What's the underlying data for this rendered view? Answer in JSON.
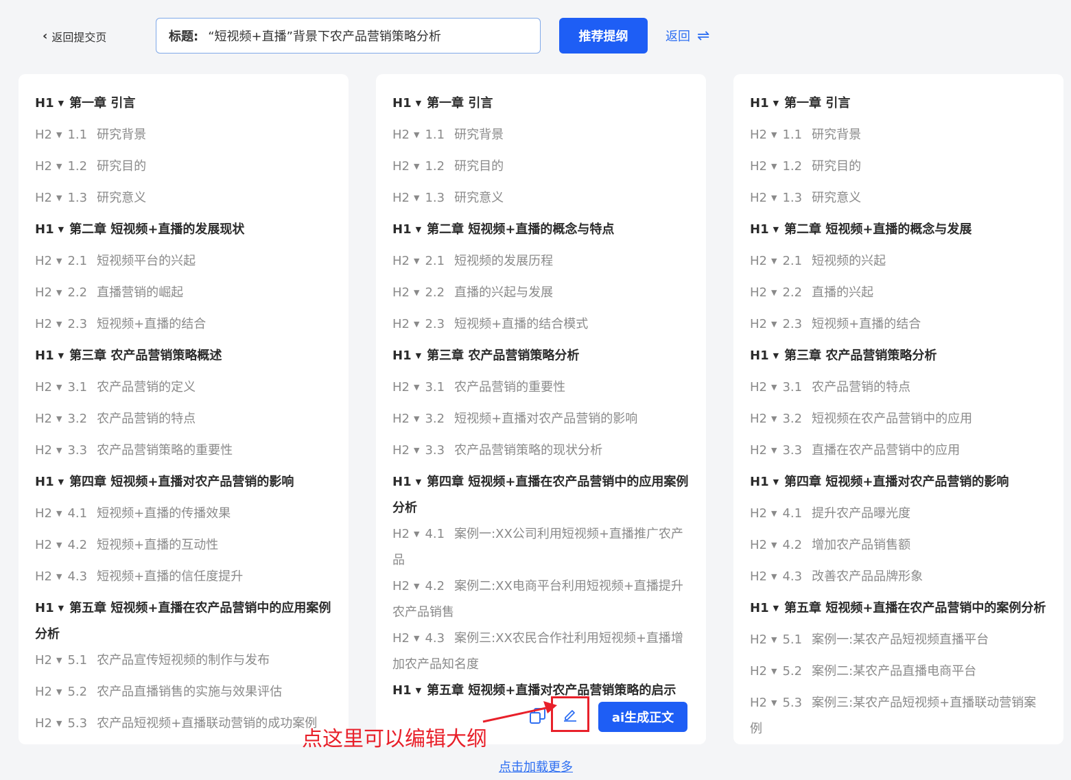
{
  "header": {
    "back_label": "返回提交页",
    "title_label": "标题:",
    "title_value": "“短视频+直播”背景下农产品营销策略分析",
    "recommend_button": "推荐提纲",
    "return_label": "返回",
    "return_icon": "swap-arrows-icon"
  },
  "outlines": [
    {
      "items": [
        {
          "level": "H1",
          "num": "",
          "text": "第一章 引言"
        },
        {
          "level": "H2",
          "num": "1.1",
          "text": "研究背景"
        },
        {
          "level": "H2",
          "num": "1.2",
          "text": "研究目的"
        },
        {
          "level": "H2",
          "num": "1.3",
          "text": "研究意义"
        },
        {
          "level": "H1",
          "num": "",
          "text": "第二章 短视频+直播的发展现状"
        },
        {
          "level": "H2",
          "num": "2.1",
          "text": "短视频平台的兴起"
        },
        {
          "level": "H2",
          "num": "2.2",
          "text": "直播营销的崛起"
        },
        {
          "level": "H2",
          "num": "2.3",
          "text": "短视频+直播的结合"
        },
        {
          "level": "H1",
          "num": "",
          "text": "第三章 农产品营销策略概述"
        },
        {
          "level": "H2",
          "num": "3.1",
          "text": "农产品营销的定义"
        },
        {
          "level": "H2",
          "num": "3.2",
          "text": "农产品营销的特点"
        },
        {
          "level": "H2",
          "num": "3.3",
          "text": "农产品营销策略的重要性"
        },
        {
          "level": "H1",
          "num": "",
          "text": "第四章 短视频+直播对农产品营销的影响"
        },
        {
          "level": "H2",
          "num": "4.1",
          "text": "短视频+直播的传播效果"
        },
        {
          "level": "H2",
          "num": "4.2",
          "text": "短视频+直播的互动性"
        },
        {
          "level": "H2",
          "num": "4.3",
          "text": "短视频+直播的信任度提升"
        },
        {
          "level": "H1",
          "num": "",
          "text": "第五章 短视频+直播在农产品营销中的应用案例分析"
        },
        {
          "level": "H2",
          "num": "5.1",
          "text": "农产品宣传短视频的制作与发布"
        },
        {
          "level": "H2",
          "num": "5.2",
          "text": "农产品直播销售的实施与效果评估"
        },
        {
          "level": "H2",
          "num": "5.3",
          "text": "农产品短视频+直播联动营销的成功案例"
        }
      ]
    },
    {
      "items": [
        {
          "level": "H1",
          "num": "",
          "text": "第一章 引言"
        },
        {
          "level": "H2",
          "num": "1.1",
          "text": "研究背景"
        },
        {
          "level": "H2",
          "num": "1.2",
          "text": "研究目的"
        },
        {
          "level": "H2",
          "num": "1.3",
          "text": "研究意义"
        },
        {
          "level": "H1",
          "num": "",
          "text": "第二章 短视频+直播的概念与特点"
        },
        {
          "level": "H2",
          "num": "2.1",
          "text": "短视频的发展历程"
        },
        {
          "level": "H2",
          "num": "2.2",
          "text": "直播的兴起与发展"
        },
        {
          "level": "H2",
          "num": "2.3",
          "text": "短视频+直播的结合模式"
        },
        {
          "level": "H1",
          "num": "",
          "text": "第三章 农产品营销策略分析"
        },
        {
          "level": "H2",
          "num": "3.1",
          "text": "农产品营销的重要性"
        },
        {
          "level": "H2",
          "num": "3.2",
          "text": "短视频+直播对农产品营销的影响"
        },
        {
          "level": "H2",
          "num": "3.3",
          "text": "农产品营销策略的现状分析"
        },
        {
          "level": "H1",
          "num": "",
          "text": "第四章 短视频+直播在农产品营销中的应用案例分析"
        },
        {
          "level": "H2",
          "num": "4.1",
          "text": "案例一:XX公司利用短视频+直播推广农产品"
        },
        {
          "level": "H2",
          "num": "4.2",
          "text": "案例二:XX电商平台利用短视频+直播提升农产品销售"
        },
        {
          "level": "H2",
          "num": "4.3",
          "text": "案例三:XX农民合作社利用短视频+直播增加农产品知名度"
        },
        {
          "level": "H1",
          "num": "",
          "text": "第五章 短视频+直播对农产品营销策略的启示"
        }
      ]
    },
    {
      "items": [
        {
          "level": "H1",
          "num": "",
          "text": "第一章 引言"
        },
        {
          "level": "H2",
          "num": "1.1",
          "text": "研究背景"
        },
        {
          "level": "H2",
          "num": "1.2",
          "text": "研究目的"
        },
        {
          "level": "H2",
          "num": "1.3",
          "text": "研究意义"
        },
        {
          "level": "H1",
          "num": "",
          "text": "第二章 短视频+直播的概念与发展"
        },
        {
          "level": "H2",
          "num": "2.1",
          "text": "短视频的兴起"
        },
        {
          "level": "H2",
          "num": "2.2",
          "text": "直播的兴起"
        },
        {
          "level": "H2",
          "num": "2.3",
          "text": "短视频+直播的结合"
        },
        {
          "level": "H1",
          "num": "",
          "text": "第三章 农产品营销策略分析"
        },
        {
          "level": "H2",
          "num": "3.1",
          "text": "农产品营销的特点"
        },
        {
          "level": "H2",
          "num": "3.2",
          "text": "短视频在农产品营销中的应用"
        },
        {
          "level": "H2",
          "num": "3.3",
          "text": "直播在农产品营销中的应用"
        },
        {
          "level": "H1",
          "num": "",
          "text": "第四章 短视频+直播对农产品营销的影响"
        },
        {
          "level": "H2",
          "num": "4.1",
          "text": "提升农产品曝光度"
        },
        {
          "level": "H2",
          "num": "4.2",
          "text": "增加农产品销售额"
        },
        {
          "level": "H2",
          "num": "4.3",
          "text": "改善农产品品牌形象"
        },
        {
          "level": "H1",
          "num": "",
          "text": "第五章 短视频+直播在农产品营销中的案例分析"
        },
        {
          "level": "H2",
          "num": "5.1",
          "text": "案例一:某农产品短视频直播平台"
        },
        {
          "level": "H2",
          "num": "5.2",
          "text": "案例二:某农产品直播电商平台"
        },
        {
          "level": "H2",
          "num": "5.3",
          "text": "案例三:某农产品短视频+直播联动营销案例"
        }
      ]
    }
  ],
  "card_actions": {
    "copy_icon": "copy-icon",
    "edit_icon": "edit-pencil-icon",
    "ai_button": "ai生成正文"
  },
  "annotation": {
    "text": "点这里可以编辑大纲",
    "color": "#e8202a"
  },
  "footer": {
    "load_more": "点击加载更多"
  },
  "colors": {
    "primary": "#1e5ef5",
    "link": "#2e6ff2",
    "h1_text": "#2b2b2b",
    "h2_text": "#8a8a8a",
    "background": "#f4f5f7"
  }
}
